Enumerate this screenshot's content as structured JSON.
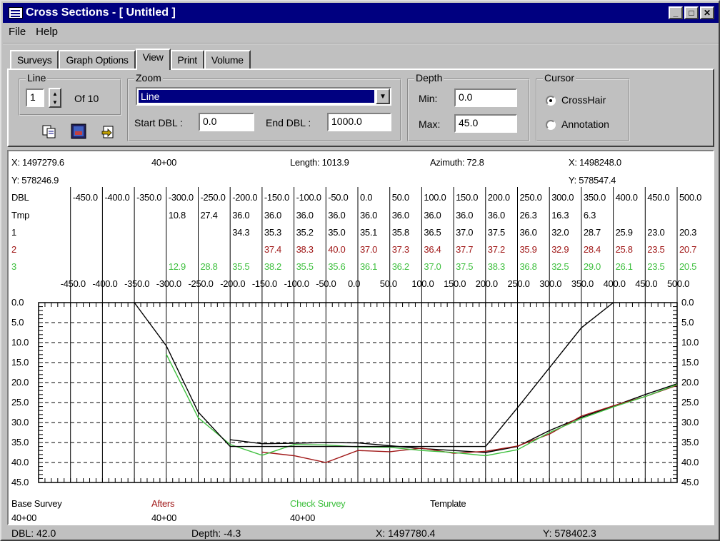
{
  "window": {
    "title": "Cross Sections - [ Untitled ]",
    "buttons": [
      "_",
      "□",
      "✕"
    ]
  },
  "menu": {
    "file": "File",
    "help": "Help"
  },
  "tabs": [
    "Surveys",
    "Graph Options",
    "View",
    "Print",
    "Volume"
  ],
  "active_tab": "View",
  "line_group": {
    "label": "Line",
    "value": "1",
    "of": "Of 10"
  },
  "zoom_group": {
    "label": "Zoom",
    "selected": "Line",
    "start_label": "Start DBL :",
    "start_value": "0.0",
    "end_label": "End DBL :",
    "end_value": "1000.0"
  },
  "depth_group": {
    "label": "Depth",
    "min_label": "Min:",
    "min_value": "0.0",
    "max_label": "Max:",
    "max_value": "45.0"
  },
  "cursor_group": {
    "label": "Cursor",
    "options": [
      "CrossHair",
      "Annotation"
    ],
    "selected": "CrossHair"
  },
  "icons": [
    "copy-icon",
    "image-icon",
    "export-icon"
  ],
  "graph_header": {
    "x_start": "X: 1497279.6",
    "y_start": "Y: 578246.9",
    "station_start": "40+00",
    "length": "Length: 1013.9",
    "azimuth": "Azimuth: 72.8",
    "x_end": "X: 1498248.0",
    "y_end": "Y: 578547.4"
  },
  "table": {
    "row_labels": [
      "DBL",
      "Tmp",
      "1",
      "2",
      "3"
    ],
    "dbl": [
      "-450.0",
      "-400.0",
      "-350.0",
      "-300.0",
      "-250.0",
      "-200.0",
      "-150.0",
      "-100.0",
      "-50.0",
      "0.0",
      "50.0",
      "100.0",
      "150.0",
      "200.0",
      "250.0",
      "300.0",
      "350.0",
      "400.0",
      "450.0",
      "500.0"
    ],
    "tmp": [
      "",
      "",
      "",
      "10.8",
      "27.4",
      "36.0",
      "36.0",
      "36.0",
      "36.0",
      "36.0",
      "36.0",
      "36.0",
      "36.0",
      "36.0",
      "26.3",
      "16.3",
      "6.3",
      "",
      "",
      ""
    ],
    "s1": [
      "",
      "",
      "",
      "",
      "",
      "34.3",
      "35.3",
      "35.2",
      "35.0",
      "35.1",
      "35.8",
      "36.5",
      "37.0",
      "37.5",
      "36.0",
      "32.0",
      "28.7",
      "25.9",
      "23.0",
      "20.3"
    ],
    "s2": [
      "",
      "",
      "",
      "",
      "",
      "",
      "37.4",
      "38.3",
      "40.0",
      "37.0",
      "37.3",
      "36.4",
      "37.7",
      "37.2",
      "35.9",
      "32.9",
      "28.4",
      "25.8",
      "23.5",
      "20.7"
    ],
    "s3": [
      "",
      "",
      "",
      "12.9",
      "28.8",
      "35.5",
      "38.2",
      "35.5",
      "35.6",
      "36.1",
      "36.2",
      "37.0",
      "37.5",
      "38.3",
      "36.8",
      "32.5",
      "29.0",
      "26.1",
      "23.5",
      "20.5"
    ]
  },
  "axis": {
    "x_ticks": [
      "-450.0",
      "-400.0",
      "-350.0",
      "-300.0",
      "-250.0",
      "-200.0",
      "-150.0",
      "-100.0",
      "-50.0",
      "0.0",
      "50.0",
      "100.0",
      "150.0",
      "200.0",
      "250.0",
      "300.0",
      "350.0",
      "400.0",
      "450.0",
      "500.0"
    ],
    "y_ticks": [
      "0.0",
      "5.0",
      "10.0",
      "15.0",
      "20.0",
      "25.0",
      "30.0",
      "35.0",
      "40.0",
      "45.0"
    ]
  },
  "chart_data": {
    "type": "line",
    "xlim": [
      -500,
      500
    ],
    "ylim": [
      0,
      45
    ],
    "series": [
      {
        "name": "Base Survey",
        "color": "#000000",
        "x": [
          -200,
          -150,
          -100,
          -50,
          0,
          50,
          100,
          150,
          200,
          250,
          300,
          350,
          400,
          450,
          500
        ],
        "y": [
          34.3,
          35.3,
          35.2,
          35.0,
          35.1,
          35.8,
          36.5,
          37.0,
          37.5,
          36.0,
          32.0,
          28.7,
          25.9,
          23.0,
          20.3
        ]
      },
      {
        "name": "Afters",
        "color": "#a01818",
        "x": [
          -150,
          -100,
          -50,
          0,
          50,
          100,
          150,
          200,
          250,
          300,
          350,
          400,
          450,
          500
        ],
        "y": [
          37.4,
          38.3,
          40.0,
          37.0,
          37.3,
          36.4,
          37.7,
          37.2,
          35.9,
          32.9,
          28.4,
          25.8,
          23.5,
          20.7
        ]
      },
      {
        "name": "Check Survey",
        "color": "#40c040",
        "x": [
          -300,
          -250,
          -200,
          -150,
          -100,
          -50,
          0,
          50,
          100,
          150,
          200,
          250,
          300,
          350,
          400,
          450,
          500
        ],
        "y": [
          12.9,
          28.8,
          35.5,
          38.2,
          35.5,
          35.6,
          36.1,
          36.2,
          37.0,
          37.5,
          38.3,
          36.8,
          32.5,
          29.0,
          26.1,
          23.5,
          20.5
        ]
      },
      {
        "name": "Template",
        "color": "#000000",
        "x": [
          -350,
          -300,
          -250,
          -200,
          -150,
          -100,
          -50,
          0,
          50,
          100,
          150,
          200,
          250,
          300,
          350,
          400
        ],
        "y": [
          0,
          10.8,
          27.4,
          36.0,
          36.0,
          36.0,
          36.0,
          36.0,
          36.0,
          36.0,
          36.0,
          36.0,
          26.3,
          16.3,
          6.3,
          0
        ]
      }
    ]
  },
  "legend": {
    "base": "Base Survey",
    "base_station": "40+00",
    "afters": "Afters",
    "afters_station": "40+00",
    "check": "Check Survey",
    "check_station": "40+00",
    "template": "Template"
  },
  "colors": {
    "afters": "#a01818",
    "check": "#40c040",
    "title_bar": "#000080"
  },
  "status": {
    "dbl": "DBL:  42.0",
    "depth": "Depth:  -4.3",
    "x": "X:  1497780.4",
    "y": "Y:  578402.3"
  }
}
